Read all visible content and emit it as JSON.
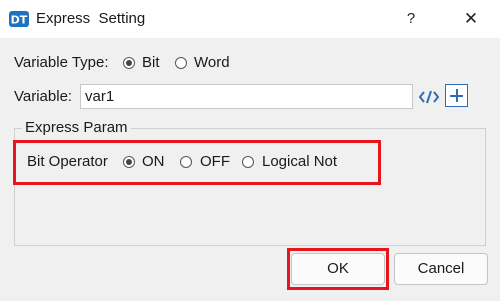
{
  "window": {
    "title": "Express  Setting",
    "help_glyph": "?",
    "close_glyph": "✕"
  },
  "variable_type": {
    "label": "Variable Type:",
    "options": [
      {
        "label": "Bit",
        "checked": true
      },
      {
        "label": "Word",
        "checked": false
      }
    ]
  },
  "variable": {
    "label": "Variable:",
    "value": "var1"
  },
  "express_param": {
    "title": "Express Param",
    "bit_operator_label": "Bit Operator",
    "options": [
      {
        "label": "ON",
        "checked": true
      },
      {
        "label": "OFF",
        "checked": false
      },
      {
        "label": "Logical Not",
        "checked": false
      }
    ]
  },
  "buttons": {
    "ok": "OK",
    "cancel": "Cancel"
  },
  "colors": {
    "highlight": "#e8141c",
    "accent": "#2e6db4"
  }
}
